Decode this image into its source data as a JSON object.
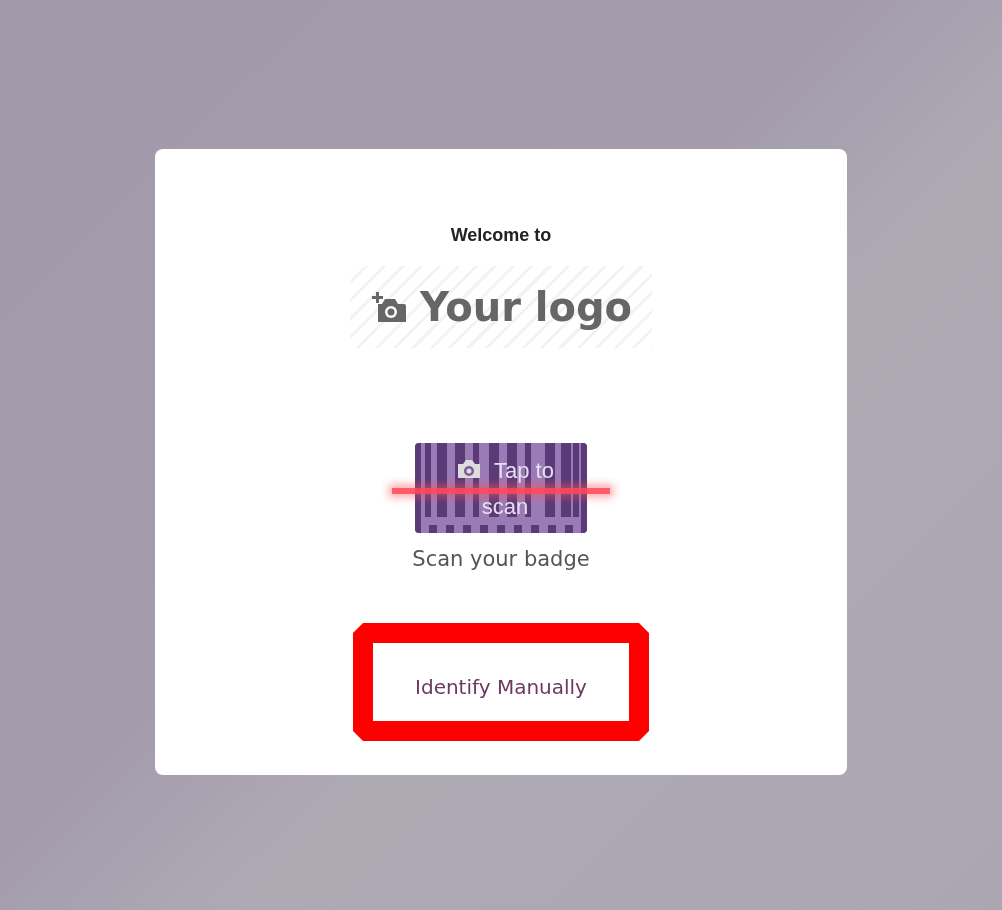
{
  "card": {
    "welcome": "Welcome to",
    "logo": {
      "text": "Your logo"
    },
    "scanner": {
      "button_text": "Tap to scan",
      "label": "Scan your badge"
    },
    "manual_button": {
      "label": "Identify Manually",
      "highlighted": true
    }
  }
}
